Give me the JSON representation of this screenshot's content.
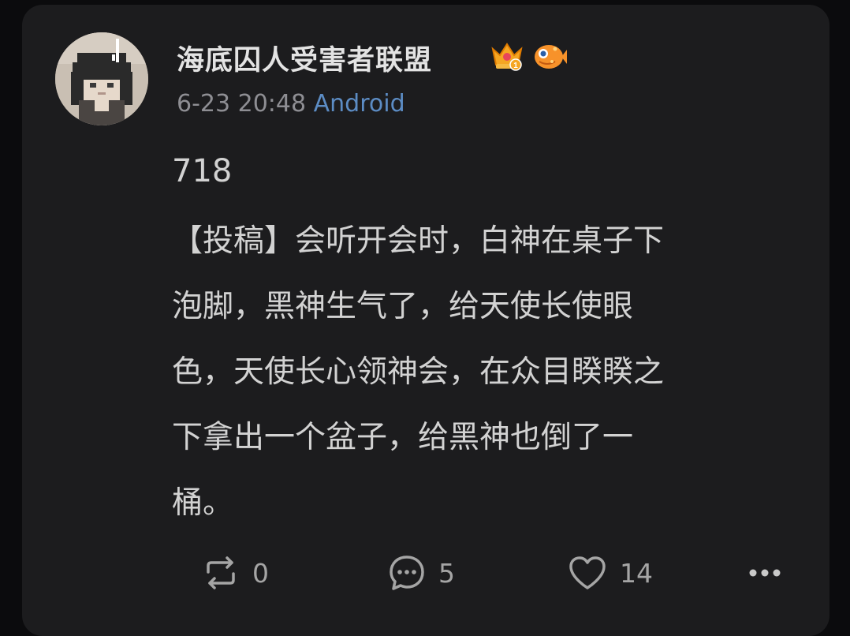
{
  "post": {
    "username": "海底囚人受害者联盟",
    "timestamp": "6-23 20:48",
    "device": "Android",
    "number": "718",
    "body_lines": [
      "【投稿】会听开会时，白神在桌子下",
      "泡脚，黑神生气了，给天使长使眼",
      "色，天使长心领神会，在众目睽睽之",
      "下拿出一个盆子，给黑神也倒了一",
      "桶。"
    ],
    "badges": [
      "crown-badge-icon",
      "fish-badge-icon"
    ]
  },
  "actions": {
    "repost_count": "0",
    "comment_count": "5",
    "like_count": "14"
  },
  "colors": {
    "background": "#0b0b0d",
    "card": "#1c1c1e",
    "text": "#d2d2d2",
    "meta": "#8e8e93",
    "device_link": "#5c8cc4"
  }
}
